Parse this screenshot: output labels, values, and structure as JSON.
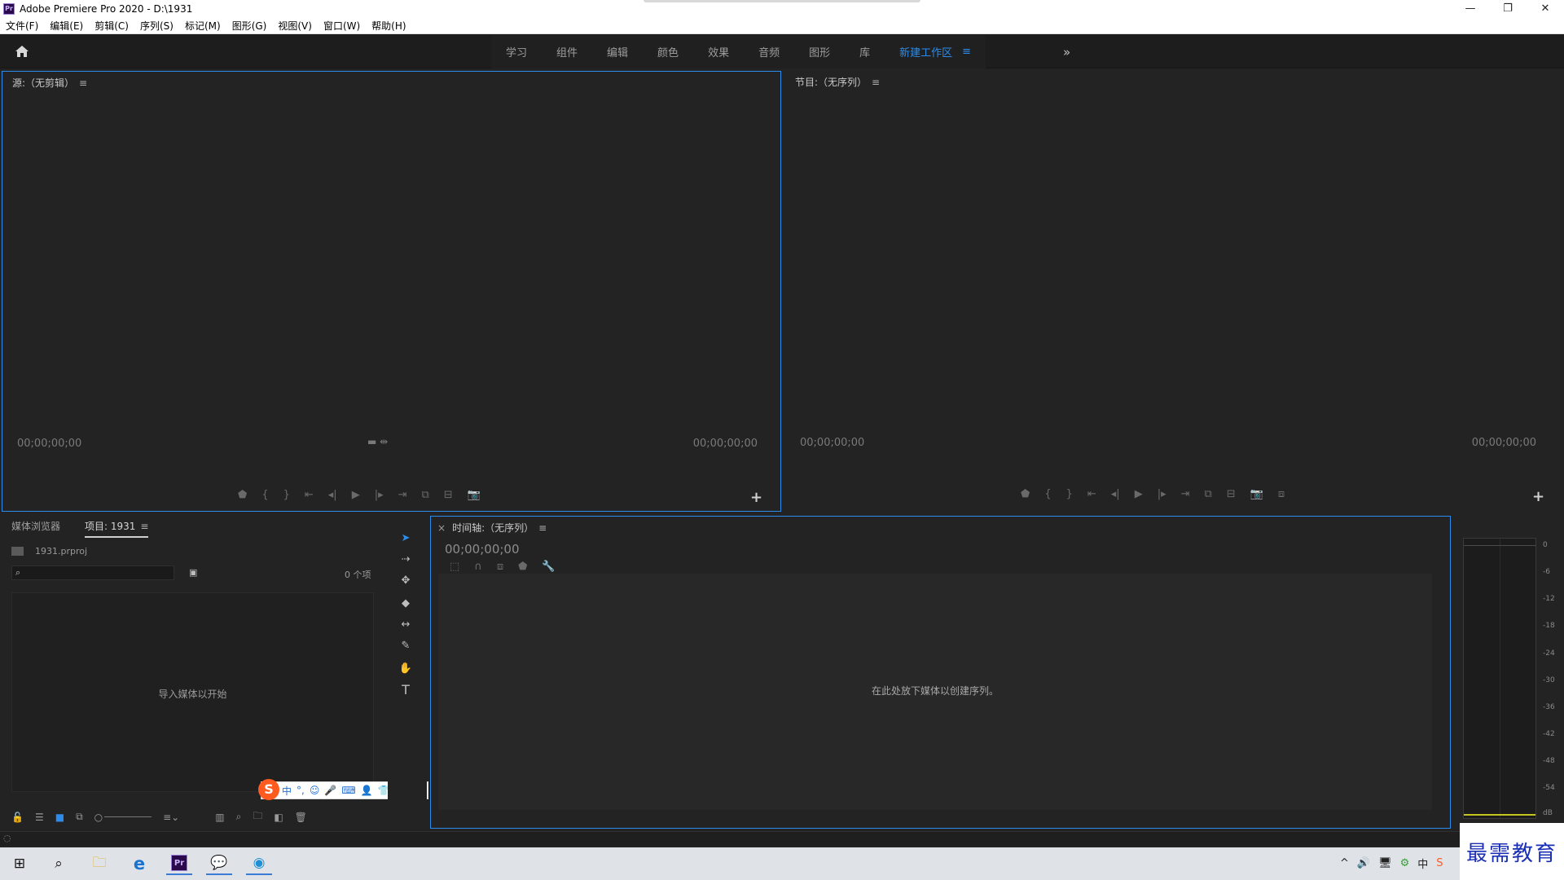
{
  "window": {
    "title": "Adobe Premiere Pro 2020 - D:\\1931",
    "app_icon": "Pr",
    "controls": [
      "—",
      "❐",
      "✕"
    ]
  },
  "menubar": [
    "文件(F)",
    "编辑(E)",
    "剪辑(C)",
    "序列(S)",
    "标记(M)",
    "图形(G)",
    "视图(V)",
    "窗口(W)",
    "帮助(H)"
  ],
  "workspaces": {
    "tabs": [
      "学习",
      "组件",
      "编辑",
      "颜色",
      "效果",
      "音频",
      "图形",
      "库"
    ],
    "active": "新建工作区",
    "menu_icon": "≡",
    "more": "»"
  },
  "source_monitor": {
    "title": "源:（无剪辑）",
    "timecode_left": "00;00;00;00",
    "timecode_right": "00;00;00;00"
  },
  "program_monitor": {
    "title": "节目:（无序列）",
    "timecode_left": "00;00;00;00",
    "timecode_right": "00;00;00;00"
  },
  "project_panel": {
    "tab_media_browser": "媒体浏览器",
    "tab_project": "项目: 1931",
    "file_name": "1931.prproj",
    "item_count": "0 个项",
    "empty_message": "导入媒体以开始"
  },
  "timeline": {
    "title": "时间轴:（无序列）",
    "close": "×",
    "timecode": "00;00;00;00",
    "empty_message": "在此处放下媒体以创建序列。"
  },
  "audio_meter": {
    "scale": [
      "0",
      "-6",
      "-12",
      "-18",
      "-24",
      "-30",
      "-36",
      "-42",
      "-48",
      "-54",
      "dB"
    ]
  },
  "ime": {
    "items": [
      "中",
      "°,",
      "☺",
      "🎤",
      "⌨",
      "👤",
      "👕",
      "▦"
    ]
  },
  "tray": [
    "^",
    "🔊",
    "🖥",
    "中"
  ],
  "watermark": "最需教育",
  "colors": {
    "accent": "#2d8ceb",
    "panel_bg": "#232323",
    "focus_border": "#2d8ceb"
  }
}
